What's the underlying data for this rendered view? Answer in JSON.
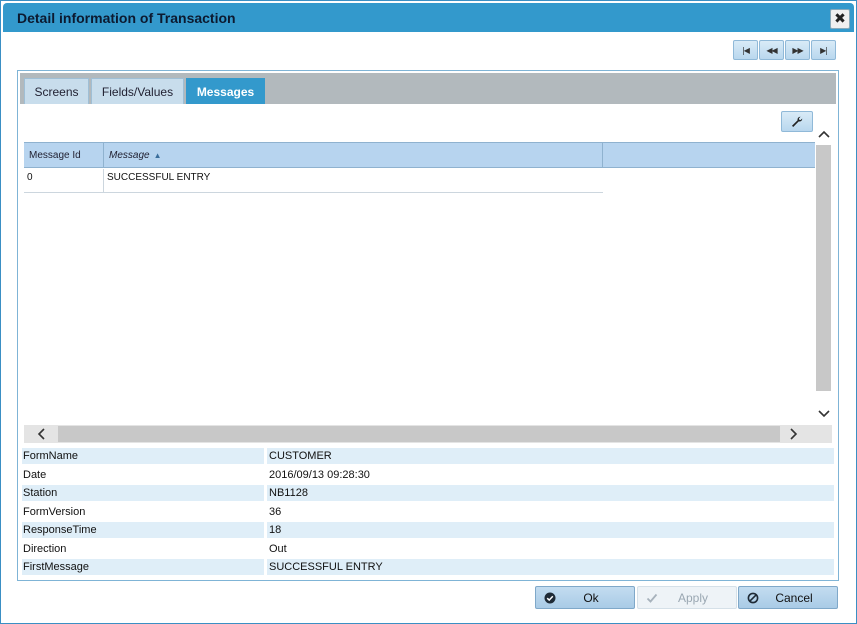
{
  "window": {
    "title": "Detail information of Transaction",
    "close_glyph": "✖"
  },
  "nav": {
    "first": "|◀",
    "prev": "◀◀",
    "next": "▶▶",
    "last": "▶|"
  },
  "tabs": [
    {
      "label": "Screens",
      "active": false
    },
    {
      "label": "Fields/Values",
      "active": false
    },
    {
      "label": "Messages",
      "active": true
    }
  ],
  "grid": {
    "columns": [
      "Message Id",
      "Message"
    ],
    "sort_column": "Message",
    "sort_direction": "asc",
    "rows": [
      {
        "id": "0",
        "message": "SUCCESSFUL ENTRY"
      }
    ]
  },
  "properties": [
    {
      "key": "FormName",
      "value": "CUSTOMER"
    },
    {
      "key": "Date",
      "value": "2016/09/13 09:28:30"
    },
    {
      "key": "Station",
      "value": "NB1128"
    },
    {
      "key": "FormVersion",
      "value": "36"
    },
    {
      "key": "ResponseTime",
      "value": "18"
    },
    {
      "key": "Direction",
      "value": "Out"
    },
    {
      "key": "FirstMessage",
      "value": "SUCCESSFUL ENTRY"
    }
  ],
  "buttons": {
    "ok": "Ok",
    "apply": "Apply",
    "cancel": "Cancel"
  },
  "colors": {
    "titlebar": "#3399cc",
    "active_tab": "#3399cc",
    "grid_header": "#b7d4ef",
    "row_stripe": "#dfeef8"
  },
  "icons": {
    "close": "close-icon",
    "tool": "wrench-icon",
    "ok": "check-circle-icon",
    "apply": "check-icon",
    "cancel": "no-entry-icon"
  }
}
